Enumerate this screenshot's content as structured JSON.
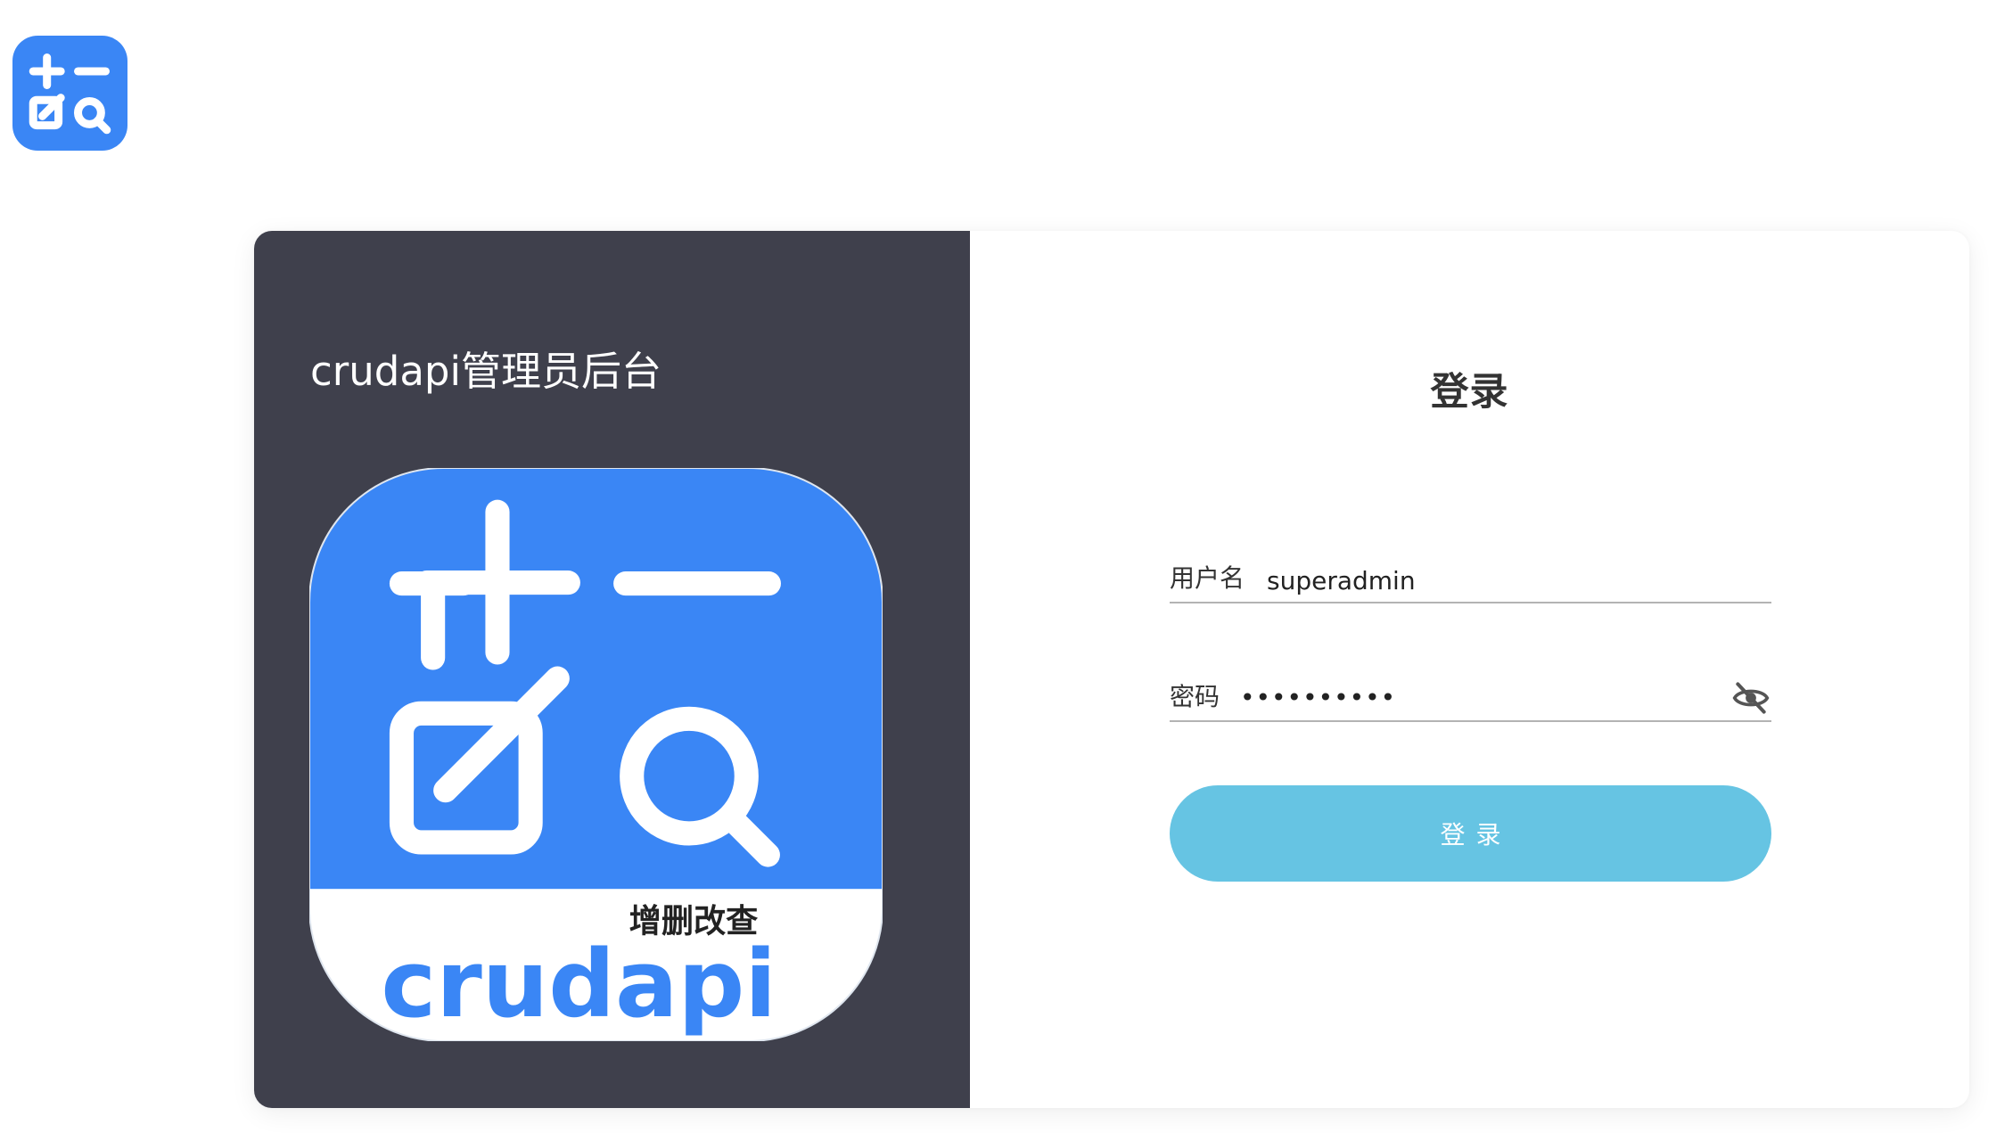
{
  "app": {
    "logo_icon": "crudapi-logo-icon",
    "brand_color": "#3a86f5"
  },
  "left_panel": {
    "title": "crudapi管理员后台",
    "logo": {
      "icon": "crudapi-app-icon",
      "tagline": "增删改查",
      "wordmark": "crudapi"
    }
  },
  "login": {
    "title": "登录",
    "username": {
      "label": "用户名",
      "value": "superadmin"
    },
    "password": {
      "label": "密码",
      "value": "••••••••••",
      "toggle_icon": "eye-off-icon"
    },
    "submit_label": "登录",
    "submit_color": "#66c4e3"
  }
}
